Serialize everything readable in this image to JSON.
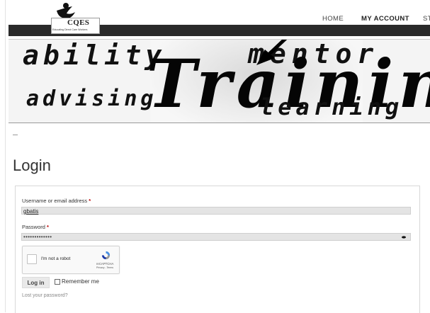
{
  "header": {
    "logo_text": "CQES",
    "logo_tagline": "Educating Direct Care Workers",
    "nav": [
      {
        "label": "HOME",
        "active": false
      },
      {
        "label": "MY ACCOUNT",
        "active": true
      },
      {
        "label": "ST",
        "active": false
      }
    ]
  },
  "banner": {
    "words": {
      "ability": "ability",
      "mentor": "mentor",
      "training": "Trainin",
      "advising": "advising",
      "learning": "learning"
    }
  },
  "divider": "—",
  "login": {
    "title": "Login",
    "username_label": "Username or email address",
    "username_value": "gbatis",
    "password_label": "Password",
    "password_mask": "•••••••••••••",
    "required_marker": "*",
    "recaptcha": {
      "label": "I'm not a robot",
      "brand": "reCAPTCHA",
      "terms": "Privacy - Terms"
    },
    "login_button": "Log in",
    "remember_label": "Remember me",
    "lost_password": "Lost your password?"
  }
}
